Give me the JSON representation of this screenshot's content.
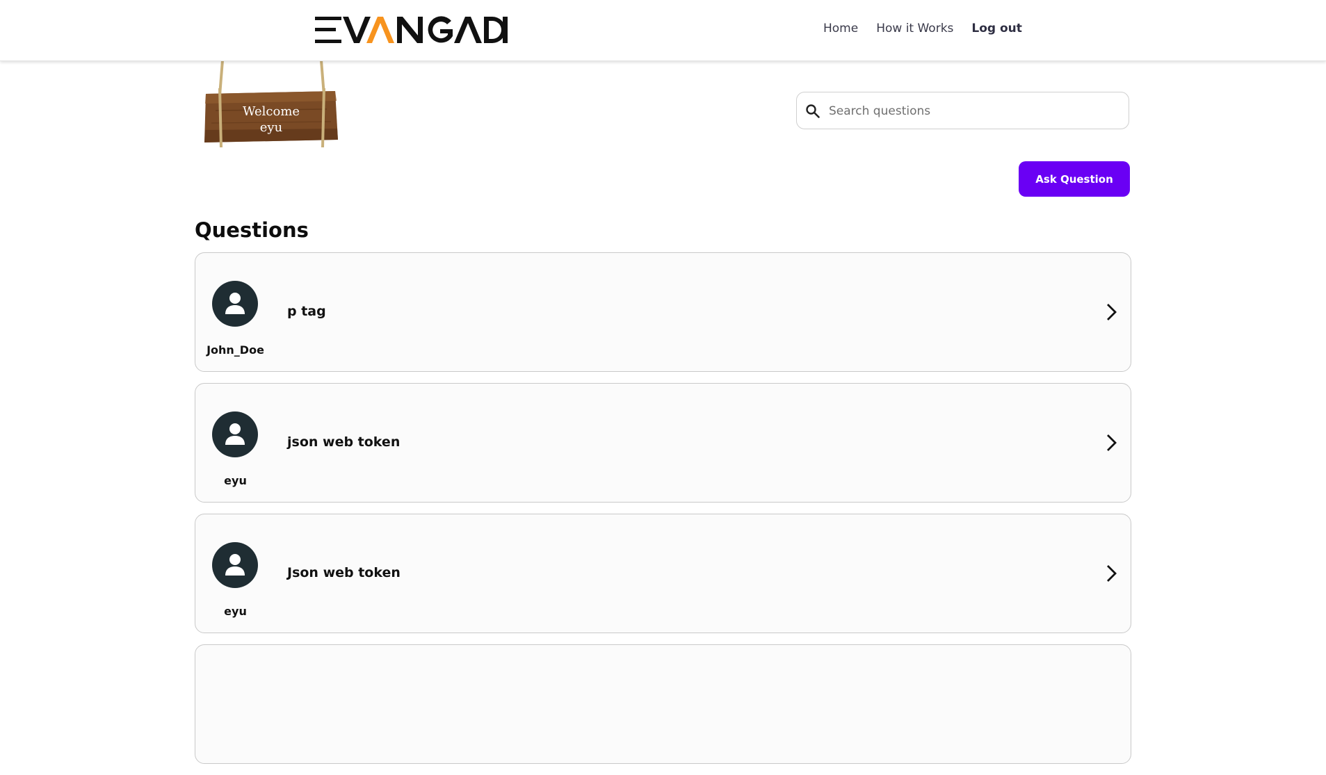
{
  "header": {
    "logo_text": "EVANGADI",
    "logo_colors": {
      "dark": "#111111",
      "accent": "#f7931e"
    },
    "nav": [
      {
        "label": "Home"
      },
      {
        "label": "How it Works"
      },
      {
        "label": "Log out"
      }
    ]
  },
  "welcome": {
    "line1": "Welcome",
    "line2": "eyu"
  },
  "search": {
    "placeholder": "Search questions",
    "value": ""
  },
  "ask_button": {
    "label": "Ask Question",
    "color": "#6a00f4"
  },
  "questions": {
    "heading": "Questions",
    "items": [
      {
        "user": "John_Doe",
        "title": "p tag"
      },
      {
        "user": "eyu",
        "title": "json web token"
      },
      {
        "user": "eyu",
        "title": "Json web token"
      },
      {
        "user": "",
        "title": ""
      }
    ]
  },
  "icons": {
    "search": "search-icon",
    "avatar": "user-avatar-icon",
    "chevron": "chevron-right-icon"
  }
}
